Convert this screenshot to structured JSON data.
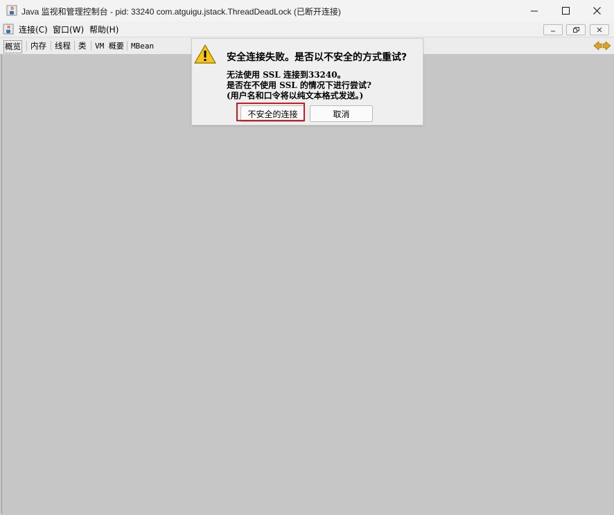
{
  "window": {
    "title": "Java 监视和管理控制台 - pid: 33240 com.atguigu.jstack.ThreadDeadLock (已断开连接)",
    "icon": "java-cup-icon"
  },
  "menubar": {
    "items": [
      "连接(C)",
      "窗口(W)",
      "帮助(H)"
    ]
  },
  "tabs": {
    "items": [
      "概览",
      "内存",
      "线程",
      "类",
      "VM 概要",
      "MBean"
    ],
    "active": "概览"
  },
  "dialog": {
    "icon": "warning-icon",
    "heading": "安全连接失败。是否以不安全的方式重试?",
    "line1": "无法使用 SSL 连接到33240。",
    "line2": "是否在不使用 SSL 的情况下进行尝试?",
    "line3": "(用户名和口令将以纯文本格式发送。)",
    "confirm_label": "不安全的连接",
    "cancel_label": "取消"
  },
  "colors": {
    "highlight": "#d4161f",
    "background": "#c6c6c6"
  }
}
